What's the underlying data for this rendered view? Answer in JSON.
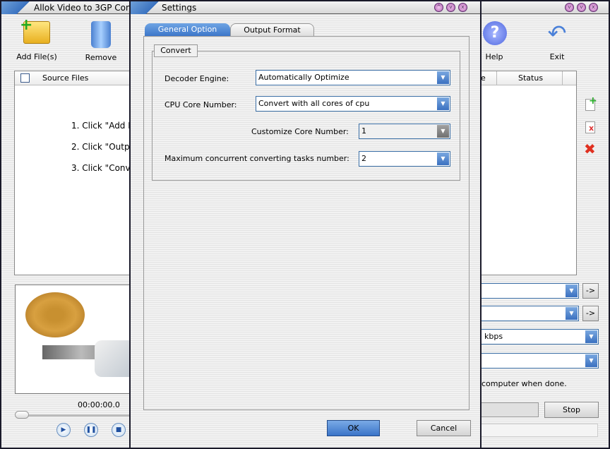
{
  "main": {
    "title": "Allok Video to 3GP Conve",
    "toolbar": {
      "add": "Add File(s)",
      "remove": "Remove",
      "help": "Help",
      "exit": "Exit"
    },
    "list": {
      "col_source": "Source Files",
      "col_partial": "e",
      "col_status": "Status"
    },
    "instructions": [
      "1. Click \"Add F",
      "2. Click \"Outpu",
      "3. Click \"Conve"
    ],
    "player": {
      "time": "00:00:00.0"
    },
    "right": {
      "bitrate": "kbps",
      "shutdown": "computer when done.",
      "stop": "Stop",
      "arrow": "->"
    }
  },
  "dialog": {
    "title": "Settings",
    "tabs": [
      "General Option",
      "Output Format"
    ],
    "group": "Convert",
    "decoder_label": "Decoder Engine:",
    "decoder_value": "Automatically Optimize",
    "cpu_label": "CPU Core Number:",
    "cpu_value": "Convert with all cores of cpu",
    "custom_label": "Customize Core Number:",
    "custom_value": "1",
    "max_label": "Maximum concurrent converting tasks number:",
    "max_value": "2",
    "ok": "OK",
    "cancel": "Cancel"
  }
}
